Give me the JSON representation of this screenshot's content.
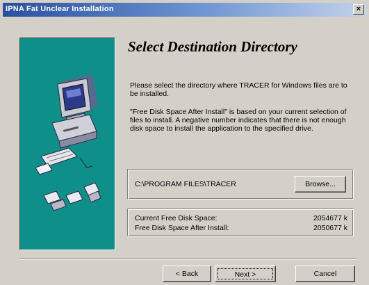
{
  "window": {
    "title": "IPNA Fat Unclear Installation",
    "close_glyph": "×"
  },
  "heading": "Select Destination Directory",
  "description": "Please select the directory where TRACER for Windows files are to be installed.",
  "note": "\"Free Disk Space After Install\" is based on your current selection of files to install. A negative number indicates that there is not enough disk space to install the application to the specified drive.",
  "destination": {
    "path": "C:\\PROGRAM FILES\\TRACER",
    "browse_label": "Browse..."
  },
  "disk_space": {
    "current_label": "Current Free Disk Space:",
    "current_value": "2054677 k",
    "after_label": "Free Disk Space After Install:",
    "after_value": "2050677 k"
  },
  "buttons": {
    "back": "< Back",
    "next": "Next >",
    "cancel": "Cancel"
  },
  "colors": {
    "graphic_bg": "#0f8f8a",
    "title_gradient_start": "#2a4fa0"
  },
  "icons": {
    "graphic": "computer-with-floppy-disks"
  }
}
